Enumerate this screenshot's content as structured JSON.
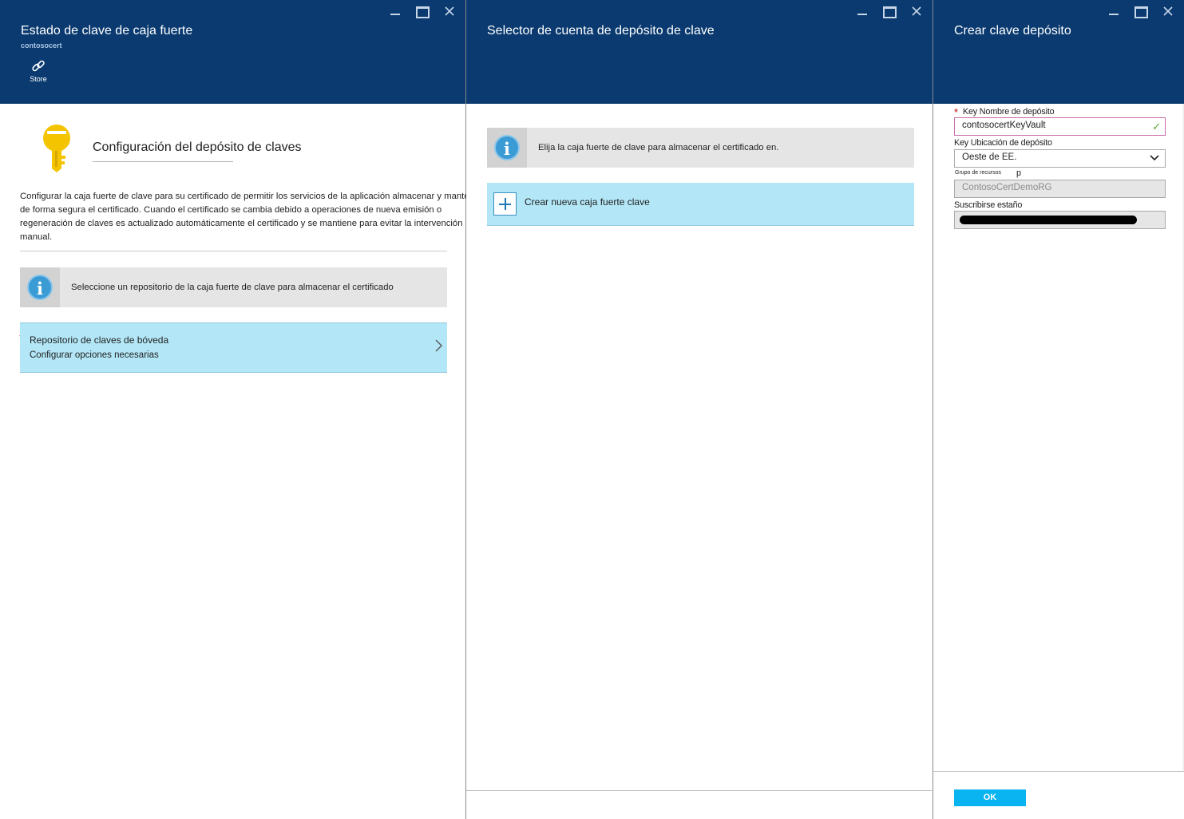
{
  "blade1": {
    "title": "Estado de clave de caja fuerte",
    "subtitle": "contosocert",
    "command_store": "Store",
    "section_title": "Configuración del depósito de claves",
    "description": "Configurar la caja fuerte de clave para su certificado de permitir los servicios de la aplicación almacenar y mantener de forma segura el certificado. Cuando el certificado se cambia debido a operaciones de nueva emisión o regeneración de claves es actualizado automáticamente el certificado y se mantiene para evitar la intervención manual.",
    "info_text": "Seleccione un repositorio de la caja fuerte de clave para almacenar el certificado",
    "nav_item_label": "Repositorio de claves de bóveda",
    "nav_item_sub": "Configurar opciones necesarias",
    "required_marker": "*"
  },
  "blade2": {
    "title": "Selector de cuenta de depósito de clave",
    "info_text": "Elija la caja fuerte de clave para almacenar el certificado en.",
    "create_label": "Crear nueva caja fuerte clave"
  },
  "blade3": {
    "title": "Crear clave depósito",
    "required_marker": "*",
    "name_label": "Key Nombre de depósito",
    "name_value": "contosocertKeyVault",
    "location_label": "Key Ubicación de depósito",
    "location_value": "Oeste de EE.",
    "resource_group_label": "Grupo de recursos",
    "resource_group_stray": "p",
    "resource_group_value": "ContosoCertDemoRG",
    "subscription_label": "Suscribirse estaño",
    "ok_label": "OK"
  },
  "colors": {
    "header_bg": "#0a3a70",
    "selection_bg": "#b3e7f7",
    "info_icon": "#3a9bd5",
    "ok_button": "#0ab4f0",
    "key_icon": "#f5c400",
    "valid_check": "#59a630"
  },
  "icons": {
    "window_controls": [
      "minimize-icon",
      "maximize-icon",
      "close-icon"
    ],
    "store": "link-icon",
    "section": "key-icon",
    "info": "info-icon",
    "create": "plus-icon",
    "nav": "chevron-right-icon",
    "dropdown": "chevron-down-icon",
    "valid": "checkmark-icon"
  }
}
